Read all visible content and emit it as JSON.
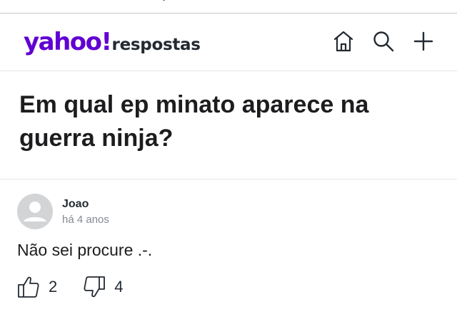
{
  "header": {
    "logo_yahoo": "yahoo!",
    "logo_product": "respostas",
    "actions": [
      {
        "name": "home",
        "icon": "home-icon"
      },
      {
        "name": "search",
        "icon": "search-icon"
      },
      {
        "name": "add",
        "icon": "plus-icon"
      }
    ]
  },
  "question": {
    "title": "Em qual ep minato aparece na guerra ninja?"
  },
  "answer": {
    "author": "Joao",
    "timestamp": "há 4 anos",
    "text": "Não sei procure .-.",
    "likes": "2",
    "dislikes": "4"
  },
  "colors": {
    "brand": "#6001d2",
    "text": "#1d1d1f",
    "muted": "#828a93",
    "avatar_bg": "#d3d4d6"
  }
}
